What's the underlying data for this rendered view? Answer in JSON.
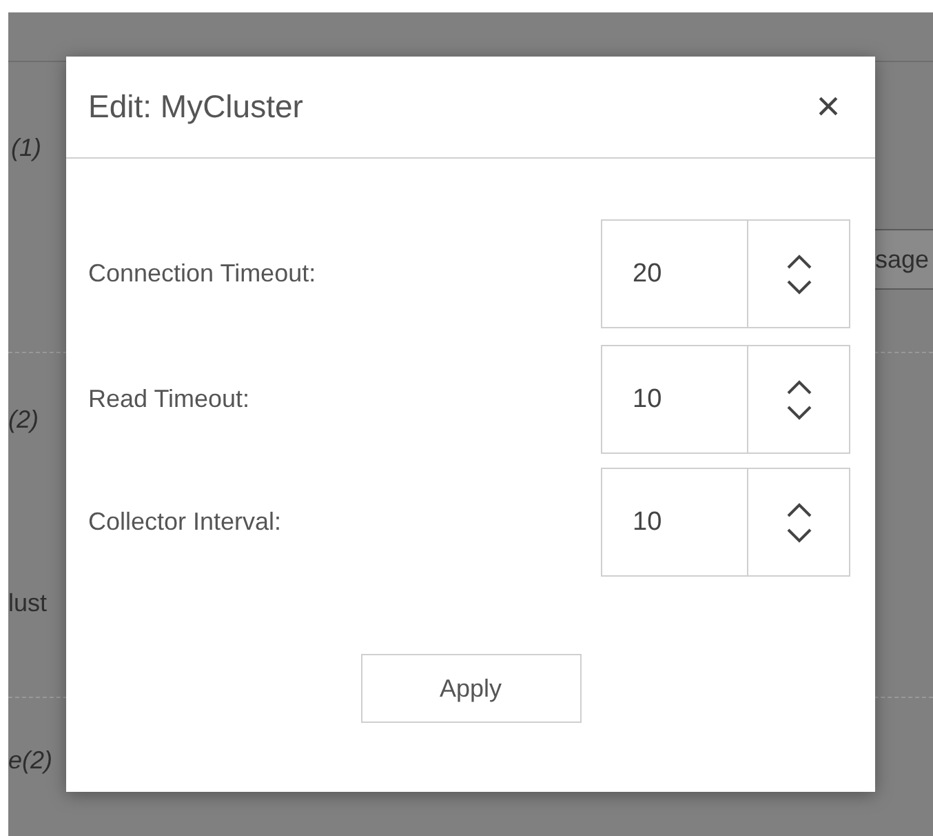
{
  "background": {
    "texts": [
      {
        "kind": "italic",
        "text": "(1)"
      },
      {
        "kind": "button",
        "text": "sage"
      },
      {
        "kind": "italic",
        "text": "(2)"
      },
      {
        "kind": "plain",
        "text": "lust"
      },
      {
        "kind": "italic",
        "text": "e(2)"
      }
    ]
  },
  "dialog": {
    "title": "Edit: MyCluster",
    "close": "×",
    "fields": [
      {
        "label": "Connection Timeout:",
        "value": "20"
      },
      {
        "label": "Read Timeout:",
        "value": "10"
      },
      {
        "label": "Collector Interval:",
        "value": "10"
      }
    ],
    "button": "Apply"
  }
}
